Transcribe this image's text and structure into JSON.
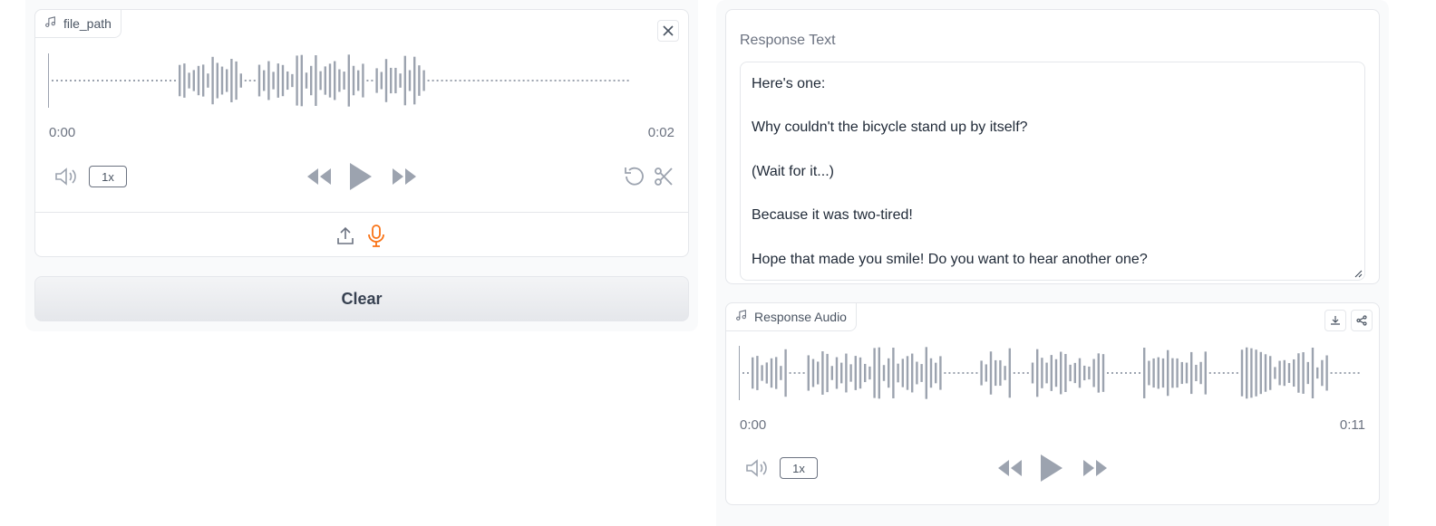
{
  "input_audio": {
    "label": "file_path",
    "current_time": "0:00",
    "duration": "0:02",
    "playback_rate": "1x"
  },
  "clear_button": {
    "label": "Clear"
  },
  "response_text": {
    "label": "Response Text",
    "lines": [
      "Here's one:",
      "",
      "Why couldn't the bicycle stand up by itself?",
      "",
      "(Wait for it...)",
      "",
      "Because it was two-tired!",
      "",
      "Hope that made you smile! Do you want to hear another one?"
    ]
  },
  "response_audio": {
    "label": "Response Audio",
    "current_time": "0:00",
    "duration": "0:11",
    "playback_rate": "1x"
  },
  "colors": {
    "accent": "#f97316",
    "icon": "#9ca3af",
    "waveform": "#9ca3af"
  },
  "icons": {
    "music": "music-note-icon",
    "close": "close-icon",
    "volume": "volume-icon",
    "rewind": "rewind-icon",
    "play": "play-icon",
    "forward": "fast-forward-icon",
    "undo": "undo-icon",
    "trim": "scissors-icon",
    "upload": "upload-icon",
    "mic": "microphone-icon",
    "download": "download-icon",
    "share": "share-icon"
  }
}
